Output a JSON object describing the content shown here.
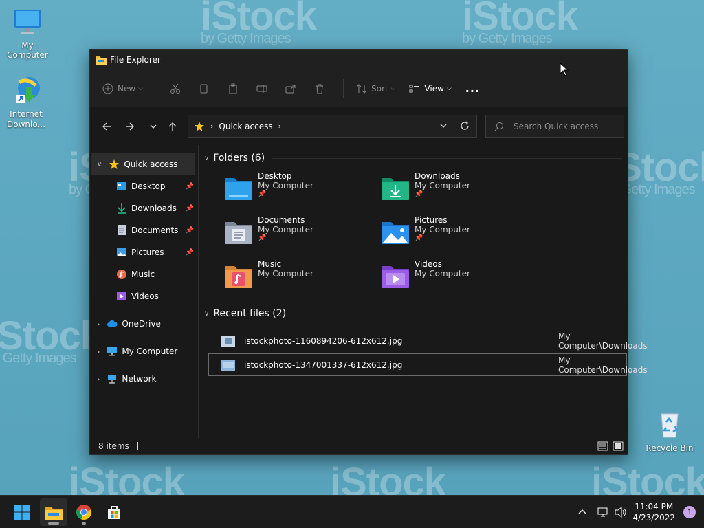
{
  "desktop": {
    "watermark_text": "iStock",
    "watermark_sub": "by Getty Images",
    "icons": [
      {
        "label": "My Computer"
      },
      {
        "label": "Internet Downlo..."
      },
      {
        "label": "Recycle Bin"
      }
    ]
  },
  "window": {
    "title": "File Explorer",
    "toolbar": {
      "new_label": "New",
      "sort_label": "Sort",
      "view_label": "View",
      "more_label": "..."
    },
    "address": {
      "crumb": "Quick access"
    },
    "search": {
      "placeholder": "Search Quick access"
    },
    "sidebar": {
      "quick_access": "Quick access",
      "items": [
        {
          "label": "Desktop",
          "pinned": true
        },
        {
          "label": "Downloads",
          "pinned": true
        },
        {
          "label": "Documents",
          "pinned": true
        },
        {
          "label": "Pictures",
          "pinned": true
        },
        {
          "label": "Music",
          "pinned": false
        },
        {
          "label": "Videos",
          "pinned": false
        }
      ],
      "onedrive": "OneDrive",
      "my_computer": "My Computer",
      "network": "Network"
    },
    "folders_header": "Folders (6)",
    "folders": [
      {
        "name": "Desktop",
        "location": "My Computer",
        "pinned": true,
        "color": "#2b9ae0"
      },
      {
        "name": "Downloads",
        "location": "My Computer",
        "pinned": true,
        "color": "#1fa67a"
      },
      {
        "name": "Documents",
        "location": "My Computer",
        "pinned": true,
        "color": "#9aa4b8"
      },
      {
        "name": "Pictures",
        "location": "My Computer",
        "pinned": true,
        "color": "#2a8fe6"
      },
      {
        "name": "Music",
        "location": "My Computer",
        "pinned": false,
        "color": "#e96a4a"
      },
      {
        "name": "Videos",
        "location": "My Computer",
        "pinned": false,
        "color": "#9b5de5"
      }
    ],
    "recent_header": "Recent files (2)",
    "recent_files": [
      {
        "name": "istockphoto-1160894206-612x612.jpg",
        "path": "My Computer\\Downloads"
      },
      {
        "name": "istockphoto-1347001337-612x612.jpg",
        "path": "My Computer\\Downloads"
      }
    ],
    "status": {
      "items": "8 items"
    }
  },
  "taskbar": {
    "time": "11:04 PM",
    "date": "4/23/2022",
    "notification_count": "1"
  }
}
